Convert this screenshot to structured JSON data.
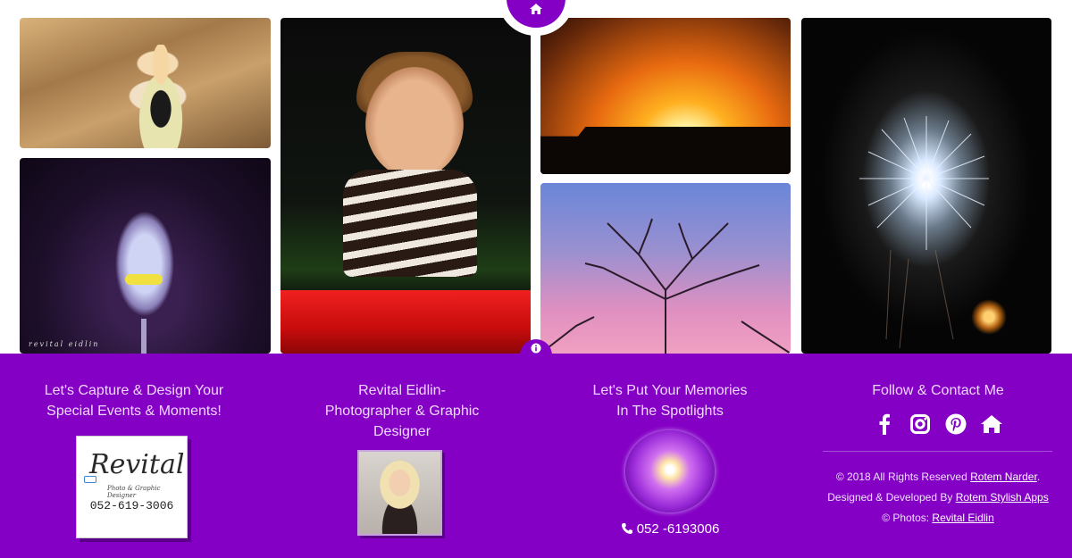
{
  "gallery": {
    "signature": "revital eidlin"
  },
  "nav": {
    "home_icon": "home-icon",
    "info_icon": "info-icon"
  },
  "footer": {
    "col1": {
      "title_line1": "Let's Capture & Design Your",
      "title_line2": "Special Events & Moments!",
      "card": {
        "logo_text": "Revital",
        "logo_sub": "Photo & Graphic Designer",
        "phone": "052-619-3006"
      }
    },
    "col2": {
      "title_line1": "Revital Eidlin-",
      "title_line2": "Photographer & Graphic",
      "title_line3": "Designer"
    },
    "col3": {
      "title_line1": "Let's Put Your Memories",
      "title_line2": "In The Spotlights",
      "phone": "052 -6193006"
    },
    "col4": {
      "title": "Follow & Contact Me",
      "icons": [
        "facebook-icon",
        "instagram-icon",
        "pinterest-icon",
        "home-icon"
      ],
      "rights_prefix": "© 2018 All Rights Reserved ",
      "rights_link": "Rotem Narder",
      "rights_suffix": ".",
      "designed_prefix": "Designed & Developed By ",
      "designed_link": "Rotem Stylish Apps",
      "photos_prefix": "© Photos: ",
      "photos_link": "Revital Eidlin"
    }
  },
  "colors": {
    "brand_purple": "#8400c4"
  }
}
